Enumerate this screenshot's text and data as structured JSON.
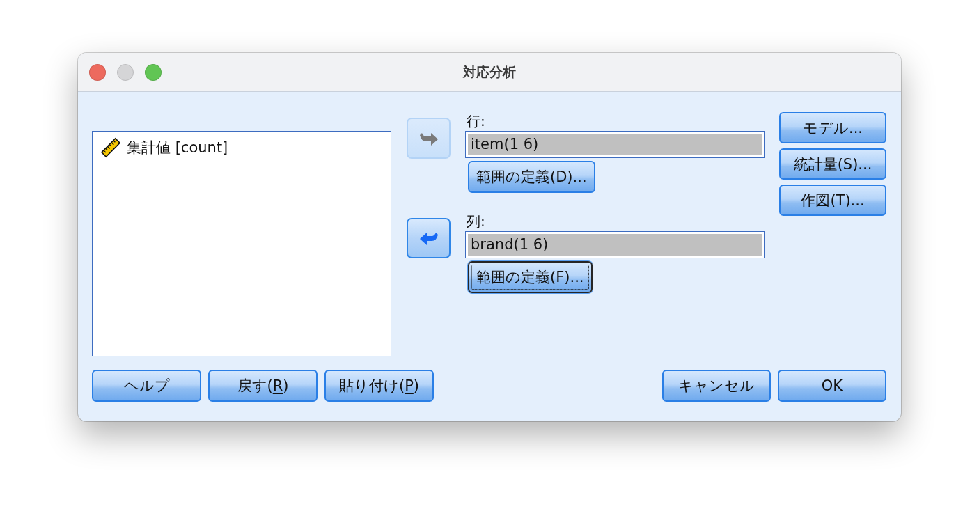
{
  "window": {
    "title": "対応分析",
    "controls": [
      {
        "kind": "close",
        "disabled": false
      },
      {
        "kind": "minimize",
        "disabled": true
      },
      {
        "kind": "zoom",
        "disabled": false
      }
    ]
  },
  "variable_list": {
    "items": [
      {
        "label": "集計値 [count]"
      }
    ]
  },
  "targets": [
    {
      "arrow": {
        "kind": "right",
        "disabled": true
      },
      "label": "行:",
      "value": "item(1 6)",
      "button": {
        "label": "範囲の定義(D)...",
        "focused": false
      }
    },
    {
      "arrow": {
        "kind": "left",
        "disabled": false
      },
      "label": "列:",
      "value": "brand(1 6)",
      "button": {
        "label": "範囲の定義(F)...",
        "focused": true
      }
    }
  ],
  "side_buttons": [
    {
      "label": "モデル..."
    },
    {
      "label": "統計量(S)..."
    },
    {
      "label": "作図(T)..."
    }
  ],
  "bottom_left_buttons": [
    {
      "label": "ヘルプ"
    },
    {
      "label_parts": [
        {
          "text": "戻す(",
          "underline": false
        },
        {
          "text": "R",
          "underline": true
        },
        {
          "text": ")",
          "underline": false
        }
      ]
    },
    {
      "label_parts": [
        {
          "text": "貼り付け(",
          "underline": false
        },
        {
          "text": "P",
          "underline": true
        },
        {
          "text": ")",
          "underline": false
        }
      ]
    }
  ],
  "bottom_right_buttons": [
    {
      "label": "キャンセル"
    },
    {
      "label": "OK"
    }
  ]
}
